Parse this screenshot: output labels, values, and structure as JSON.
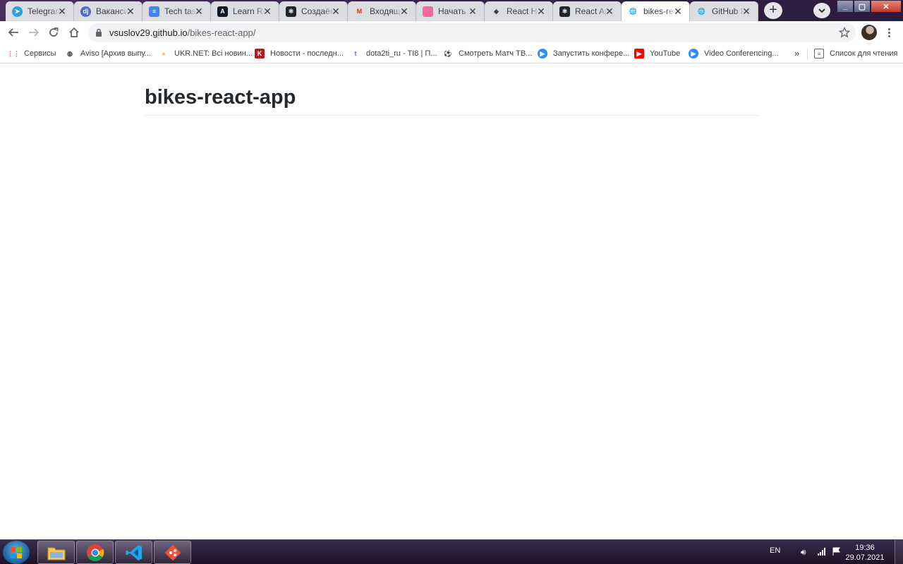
{
  "browser": {
    "tabs": [
      {
        "title": "Telegram",
        "icon": "telegram-icon",
        "color": "#2aa3e0",
        "glyph": "➤"
      },
      {
        "title": "Вакансии",
        "icon": "djinni-icon",
        "color": "#4a6cd4",
        "glyph": "dj"
      },
      {
        "title": "Tech task",
        "icon": "google-docs-icon",
        "color": "#4285f4",
        "glyph": "≡"
      },
      {
        "title": "Learn React",
        "icon": "a-logo-icon",
        "color": "#111827",
        "glyph": "A"
      },
      {
        "title": "Создаём",
        "icon": "react-icon",
        "color": "#20232a",
        "glyph": "⚛"
      },
      {
        "title": "Входящие",
        "icon": "gmail-icon",
        "color": "#ffffff",
        "glyph": "M"
      },
      {
        "title": "Начать",
        "icon": "pink-square-icon",
        "color": "#f26b9c",
        "glyph": ""
      },
      {
        "title": "React Hooks",
        "icon": "cube-icon",
        "color": "#3c4043",
        "glyph": "◆"
      },
      {
        "title": "React App",
        "icon": "react-icon",
        "color": "#20232a",
        "glyph": "⚛"
      },
      {
        "title": "bikes-react-app",
        "icon": "globe-icon",
        "color": "#5f6368",
        "glyph": "🌐",
        "active": true
      },
      {
        "title": "GitHub Pages",
        "icon": "globe-icon",
        "color": "#5f6368",
        "glyph": "🌐"
      }
    ],
    "url_host": "vsuslov29.github.io",
    "url_path": "/bikes-react-app/",
    "bookmarks": [
      {
        "label": "Сервисы",
        "icon": "apps-grid-icon",
        "color": "#ea4335",
        "glyph": "⋮⋮"
      },
      {
        "label": "Aviso [Архив выпу...",
        "icon": "globe-icon",
        "color": "#3c4043",
        "glyph": "◍"
      },
      {
        "label": "UKR.NET: Всі новин...",
        "icon": "ukrnet-icon",
        "color": "#f2c94c",
        "glyph": "●"
      },
      {
        "label": "Новости - последн...",
        "icon": "k-logo-icon",
        "color": "#b71c1c",
        "glyph": "K"
      },
      {
        "label": "dota2ti_ru - TI8 | П...",
        "icon": "twitch-icon",
        "color": "#9146ff",
        "glyph": "t"
      },
      {
        "label": "Смотреть Матч ТВ...",
        "icon": "soccer-ball-icon",
        "color": "#222222",
        "glyph": "⚽"
      },
      {
        "label": "Запустить конфере...",
        "icon": "zoom-icon",
        "color": "#2d8cff",
        "glyph": "▶"
      },
      {
        "label": "YouTube",
        "icon": "youtube-icon",
        "color": "#ff0000",
        "glyph": "▶"
      },
      {
        "label": "Video Conferencing...",
        "icon": "zoom-icon",
        "color": "#2d8cff",
        "glyph": "▶"
      }
    ],
    "more_bookmarks": "»",
    "reading_list": "Список для чтения"
  },
  "page": {
    "title": "bikes-react-app"
  },
  "taskbar": {
    "apps": [
      {
        "name": "explorer",
        "icon": "folder-icon"
      },
      {
        "name": "chrome",
        "icon": "chrome-icon"
      },
      {
        "name": "vscode",
        "icon": "vscode-icon"
      },
      {
        "name": "git-gui",
        "icon": "git-icon"
      }
    ],
    "language": "EN",
    "time": "19:36",
    "date": "29.07.2021"
  }
}
